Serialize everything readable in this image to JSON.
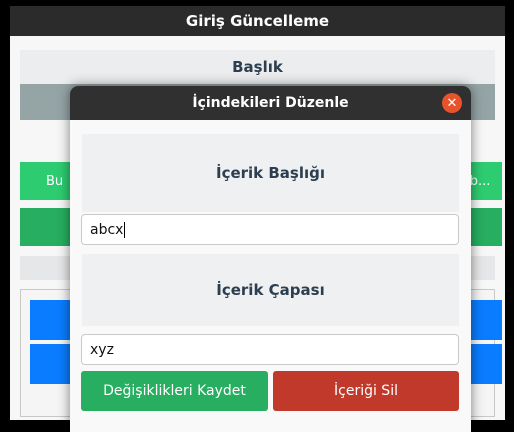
{
  "background_window": {
    "title": "Giriş Güncelleme",
    "heading": "Başlık",
    "green_left_text": "Bu",
    "green_right_text": "i b..."
  },
  "dialog": {
    "title": "İçindekileri Düzenle",
    "close_icon": "close-icon",
    "section_title_label": "İçerik Başlığı",
    "title_value": "abcx",
    "section_anchor_label": "İçerik Çapası",
    "anchor_value": "xyz",
    "save_label": "Değişiklikleri Kaydet",
    "delete_label": "İçeriği Sil"
  },
  "colors": {
    "save_button": "#27ae60",
    "delete_button": "#c0392b",
    "close_button": "#e9532b",
    "titlebar": "#303030"
  }
}
